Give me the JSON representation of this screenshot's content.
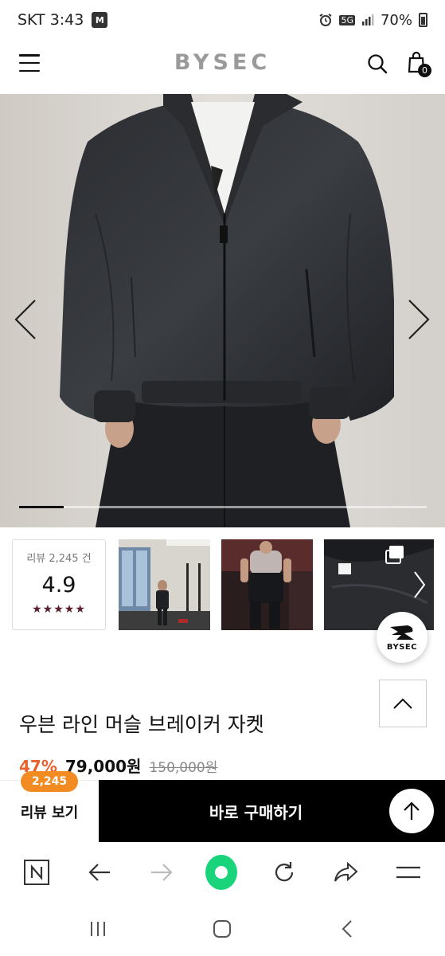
{
  "status_bar": {
    "carrier_time": "SKT 3:43",
    "m_badge": "M",
    "network": "5G",
    "battery": "70%"
  },
  "header": {
    "logo": "BYSEC",
    "cart_count": "0"
  },
  "hero": {
    "slide_progress": 0.11
  },
  "reviews": {
    "count_label": "리뷰 2,245 건",
    "score": "4.9",
    "stars": "★★★★★"
  },
  "fab": {
    "label": "BYSEC"
  },
  "product": {
    "title": "우븐 라인 머슬 브레이커 자켓",
    "discount": "47%",
    "price": "79,000원",
    "original_price": "150,000원"
  },
  "action_bar": {
    "review_badge": "2,245",
    "review_label": "리뷰 보기",
    "buy_label": "바로 구매하기"
  },
  "colors": {
    "accent_orange": "#f28c22",
    "discount_red": "#e8612c",
    "buy_black": "#000000",
    "browser_green": "#19d47a"
  }
}
